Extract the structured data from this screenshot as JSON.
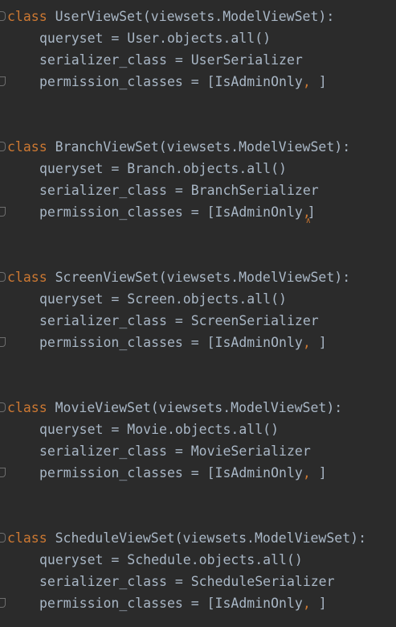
{
  "editor": {
    "background": "#2b2b2b",
    "keyword_color": "#cc7832",
    "text_color": "#a9b7c6",
    "blocks": [
      {
        "keyword": "class",
        "header": " UserViewSet(viewsets.ModelViewSet):",
        "queryset": "queryset = User.objects.all()",
        "serializer": "serializer_class = UserSerializer",
        "permission_prefix": "permission_classes = [IsAdminOnly",
        "comma": ",",
        "permission_suffix": " ]"
      },
      {
        "keyword": "class",
        "header": " BranchViewSet(viewsets.ModelViewSet):",
        "queryset": "queryset = Branch.objects.all()",
        "serializer": "serializer_class = BranchSerializer",
        "permission_prefix": "permission_classes = [IsAdminOnly",
        "comma": ",",
        "permission_suffix": "]"
      },
      {
        "keyword": "class",
        "header": " ScreenViewSet(viewsets.ModelViewSet):",
        "queryset": "queryset = Screen.objects.all()",
        "serializer": "serializer_class = ScreenSerializer",
        "permission_prefix": "permission_classes = [IsAdminOnly",
        "comma": ",",
        "permission_suffix": " ]"
      },
      {
        "keyword": "class",
        "header": " MovieViewSet(viewsets.ModelViewSet):",
        "queryset": "queryset = Movie.objects.all()",
        "serializer": "serializer_class = MovieSerializer",
        "permission_prefix": "permission_classes = [IsAdminOnly",
        "comma": ",",
        "permission_suffix": " ]"
      },
      {
        "keyword": "class",
        "header": " ScheduleViewSet(viewsets.ModelViewSet):",
        "queryset": "queryset = Schedule.objects.all()",
        "serializer": "serializer_class = ScheduleSerializer",
        "permission_prefix": "permission_classes = [IsAdminOnly",
        "comma": ",",
        "permission_suffix": " ]"
      }
    ]
  }
}
